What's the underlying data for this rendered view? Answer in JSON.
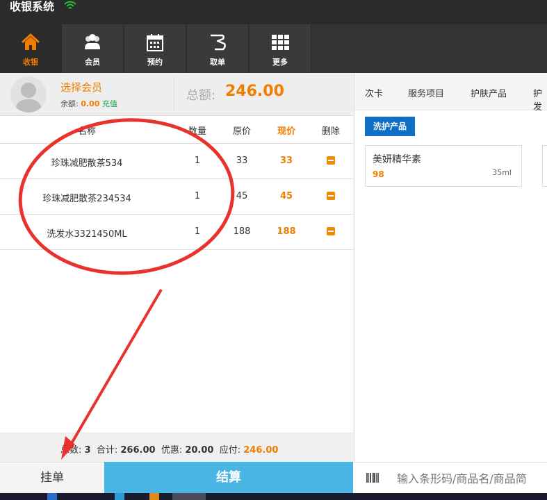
{
  "app": {
    "title": "收银系统"
  },
  "toolbar": [
    {
      "label": "收银",
      "icon": "home-icon",
      "active": true
    },
    {
      "label": "会员",
      "icon": "members-icon",
      "active": false
    },
    {
      "label": "预约",
      "icon": "calendar-icon",
      "active": false
    },
    {
      "label": "取单",
      "icon": "take-order-icon",
      "active": false
    },
    {
      "label": "更多",
      "icon": "grid-icon",
      "active": false
    }
  ],
  "member": {
    "select_label": "选择会员",
    "balance_label": "余额:",
    "balance_value": "0.00",
    "recharge_label": "充值"
  },
  "total": {
    "label": "总额:",
    "value": "246.00"
  },
  "table": {
    "headers": [
      "名称",
      "数量",
      "原价",
      "现价",
      "删除"
    ],
    "rows": [
      {
        "name": "珍珠减肥散茶534",
        "qty": "1",
        "orig": "33",
        "price": "33"
      },
      {
        "name": "珍珠减肥散茶234534",
        "qty": "1",
        "orig": "45",
        "price": "45"
      },
      {
        "name": "洗发水3321450ML",
        "qty": "1",
        "orig": "188",
        "price": "188"
      }
    ]
  },
  "summary": {
    "count_label": "总数:",
    "count": "3",
    "sum_label": "合计:",
    "sum": "266.00",
    "discount_label": "优惠:",
    "discount": "20.00",
    "due_label": "应付:",
    "due": "246.00"
  },
  "actions": {
    "hang": "挂单",
    "settle": "结算"
  },
  "search": {
    "placeholder": "输入条形码/商品名/商品简"
  },
  "categories": [
    "次卡",
    "服务项目",
    "护肤产品",
    "护发"
  ],
  "subcategory": "洗护产品",
  "products": [
    {
      "name": "美妍精华素",
      "price": "98",
      "spec": "35ml"
    }
  ],
  "colors": {
    "accent": "#f07c00",
    "settle": "#4ab4e2",
    "tab_blue": "#0f6fc4",
    "toolbar": "#333333",
    "annotation": "#e8322e"
  }
}
